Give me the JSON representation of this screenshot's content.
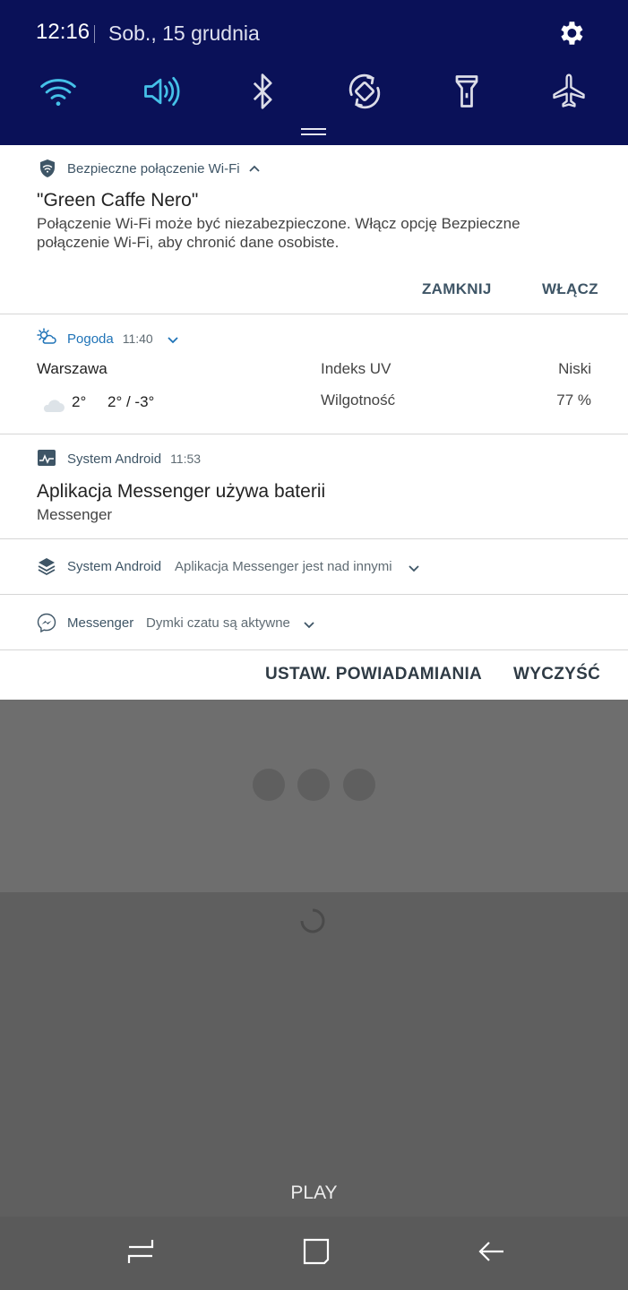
{
  "status": {
    "time": "12:16",
    "date": "Sob., 15 grudnia"
  },
  "quick_tiles": [
    "wifi-icon",
    "sound-icon",
    "bluetooth-icon",
    "auto-rotate-icon",
    "flashlight-icon",
    "airplane-mode-icon"
  ],
  "colors": {
    "quick_bg": "#0a1158",
    "active_tile": "#45c1e8",
    "inactive_tile": "#dcdde8",
    "accent_blue": "#1f73b7"
  },
  "wifi_secure": {
    "app": "Bezpieczne połączenie Wi-Fi",
    "title": "\"Green Caffe Nero\"",
    "body_line1": "Połączenie Wi-Fi może być niezabezpieczone. Włącz opcję Bezpieczne",
    "body_line2": "połączenie Wi-Fi, aby chronić dane osobiste.",
    "close_label": "ZAMKNIJ",
    "enable_label": "WŁĄCZ"
  },
  "weather": {
    "app": "Pogoda",
    "time": "11:40",
    "city": "Warszawa",
    "current": "2°",
    "range": "2° / -3°",
    "uv_label": "Indeks UV",
    "uv_value": "Niski",
    "humidity_label": "Wilgotność",
    "humidity_value": "77 %"
  },
  "android_battery": {
    "app": "System Android",
    "time": "11:53",
    "title": "Aplikacja Messenger używa baterii",
    "subtitle": "Messenger"
  },
  "android_overlay": {
    "app": "System Android",
    "text": "Aplikacja Messenger jest nad innymi"
  },
  "messenger": {
    "app": "Messenger",
    "text": "Dymki czatu są aktywne"
  },
  "footer": {
    "settings_label": "USTAW. POWIADAMIANIA",
    "clear_label": "WYCZYŚĆ"
  },
  "background_app": {
    "play_label": "PLAY"
  },
  "nav": [
    "recents-icon",
    "home-icon",
    "back-icon"
  ]
}
